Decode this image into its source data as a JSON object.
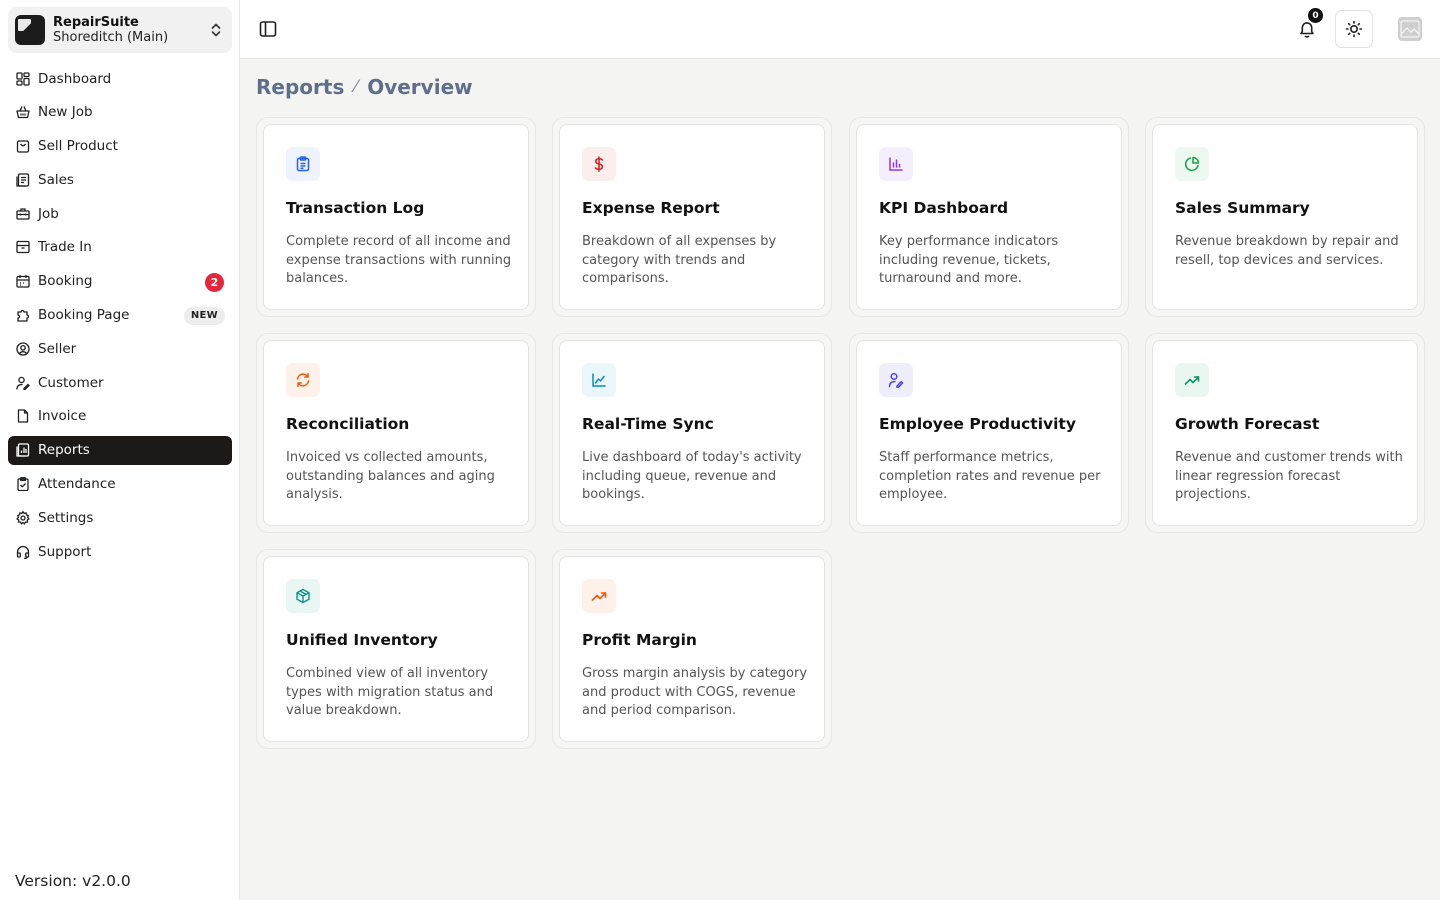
{
  "org": {
    "name": "RepairSuite",
    "branch": "Shoreditch (Main)"
  },
  "nav": [
    {
      "label": "Dashboard",
      "icon": "grid-icon"
    },
    {
      "label": "New Job",
      "icon": "basket-icon"
    },
    {
      "label": "Sell Product",
      "icon": "bag-icon"
    },
    {
      "label": "Sales",
      "icon": "ledger-icon"
    },
    {
      "label": "Job",
      "icon": "toolbox-icon"
    },
    {
      "label": "Trade In",
      "icon": "archive-icon"
    },
    {
      "label": "Booking",
      "icon": "calendar-icon",
      "badge": "2"
    },
    {
      "label": "Booking Page",
      "icon": "puzzle-icon",
      "tag": "NEW"
    },
    {
      "label": "Seller",
      "icon": "user-circle-icon"
    },
    {
      "label": "Customer",
      "icon": "user-edit-icon"
    },
    {
      "label": "Invoice",
      "icon": "file-icon"
    },
    {
      "label": "Reports",
      "icon": "report-icon",
      "active": true
    },
    {
      "label": "Attendance",
      "icon": "clipboard-check-icon"
    },
    {
      "label": "Settings",
      "icon": "gear-icon"
    },
    {
      "label": "Support",
      "icon": "headset-icon"
    }
  ],
  "version": "Version: v2.0.0",
  "topbar": {
    "notification_count": "0"
  },
  "breadcrumb": {
    "root": "Reports",
    "current": "Overview"
  },
  "cards": [
    {
      "title": "Transaction Log",
      "desc": "Complete record of all income and expense transactions with running balances.",
      "icon": "clipboard-list-icon",
      "color": "#2563eb",
      "bg": "#eef3fd"
    },
    {
      "title": "Expense Report",
      "desc": "Breakdown of all expenses by category with trends and comparisons.",
      "icon": "dollar-icon",
      "color": "#dc2626",
      "bg": "#fdeeee"
    },
    {
      "title": "KPI Dashboard",
      "desc": "Key performance indicators including revenue, tickets, turnaround and more.",
      "icon": "bar-chart-icon",
      "color": "#9333ea",
      "bg": "#f5eefc"
    },
    {
      "title": "Sales Summary",
      "desc": "Revenue breakdown by repair and resell, top devices and services.",
      "icon": "pie-chart-icon",
      "color": "#16a34a",
      "bg": "#ecf8f0"
    },
    {
      "title": "Reconciliation",
      "desc": "Invoiced vs collected amounts, outstanding balances and aging analysis.",
      "icon": "refresh-icon",
      "color": "#ea580c",
      "bg": "#fdf1ea"
    },
    {
      "title": "Real-Time Sync",
      "desc": "Live dashboard of today's activity including queue, revenue and bookings.",
      "icon": "line-chart-icon",
      "color": "#0891b2",
      "bg": "#eaf6f9"
    },
    {
      "title": "Employee Productivity",
      "desc": "Staff performance metrics, completion rates and revenue per employee.",
      "icon": "user-pen-icon",
      "color": "#4f46e5",
      "bg": "#eeeefc"
    },
    {
      "title": "Growth Forecast",
      "desc": "Revenue and customer trends with linear regression forecast projections.",
      "icon": "trending-up-icon",
      "color": "#059669",
      "bg": "#eaf7f1"
    },
    {
      "title": "Unified Inventory",
      "desc": "Combined view of all inventory types with migration status and value breakdown.",
      "icon": "package-icon",
      "color": "#0d9488",
      "bg": "#e9f6f4"
    },
    {
      "title": "Profit Margin",
      "desc": "Gross margin analysis by category and product with COGS, revenue and period comparison.",
      "icon": "trending-up-icon",
      "color": "#ea580c",
      "bg": "#fdf1ea"
    }
  ]
}
